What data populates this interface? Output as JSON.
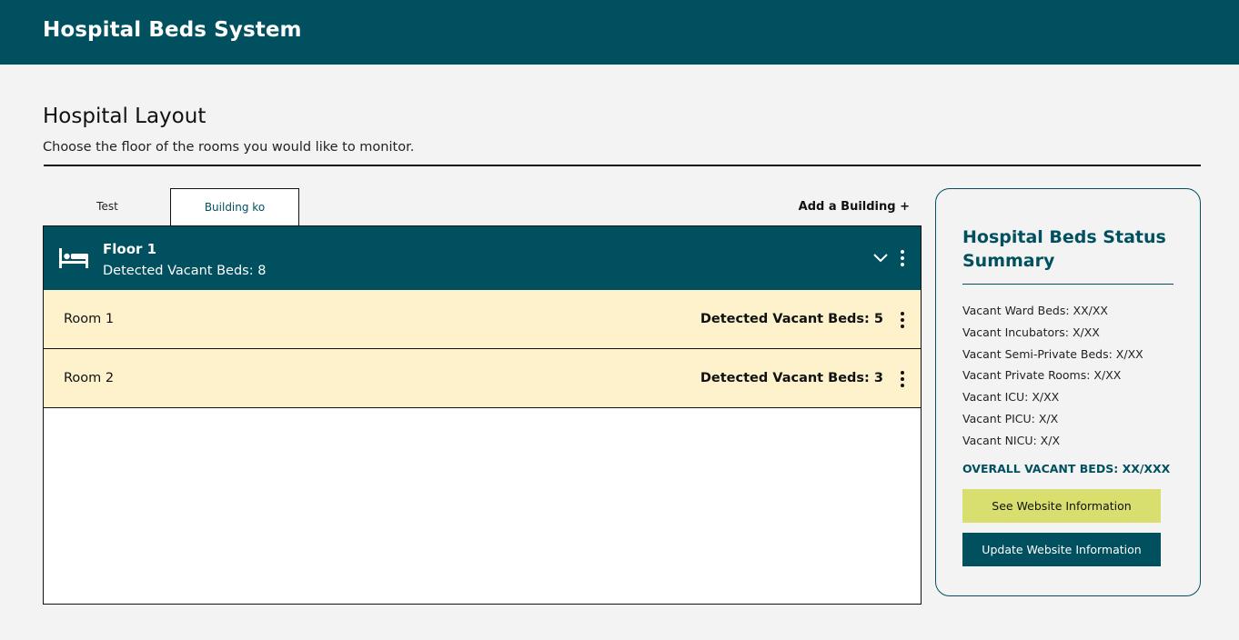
{
  "app": {
    "title": "Hospital Beds System"
  },
  "page": {
    "title": "Hospital Layout",
    "subtitle": "Choose the floor of the rooms you would like to monitor."
  },
  "tabs": [
    {
      "label": "Test",
      "active": false
    },
    {
      "label": "Building ko",
      "active": true
    }
  ],
  "add_building_label": "Add a Building +",
  "floor": {
    "name": "Floor 1",
    "vacant_text": "Detected Vacant Beds: 8",
    "icon": "bed-icon",
    "expand_icon": "chevron-down-icon",
    "menu_icon": "more-vertical-icon"
  },
  "rooms": [
    {
      "name": "Room 1",
      "vacant_text": "Detected Vacant Beds: 5"
    },
    {
      "name": "Room 2",
      "vacant_text": "Detected Vacant Beds: 3"
    }
  ],
  "summary": {
    "title": "Hospital Beds Status Summary",
    "items": [
      "Vacant Ward Beds: XX/XX",
      "Vacant Incubators: X/XX",
      "Vacant Semi-Private Beds: X/XX",
      "Vacant Private Rooms: X/XX",
      "Vacant ICU: X/XX",
      "Vacant PICU: X/X",
      "Vacant NICU: X/X"
    ],
    "overall": "OVERALL VACANT BEDS: XX/XXX",
    "see_button": "See Website Information",
    "update_button": "Update Website Information"
  },
  "colors": {
    "brand": "#00505f",
    "room_row": "#fdf2cc",
    "see_button": "#d9df6e",
    "background": "#f3f3f3"
  }
}
